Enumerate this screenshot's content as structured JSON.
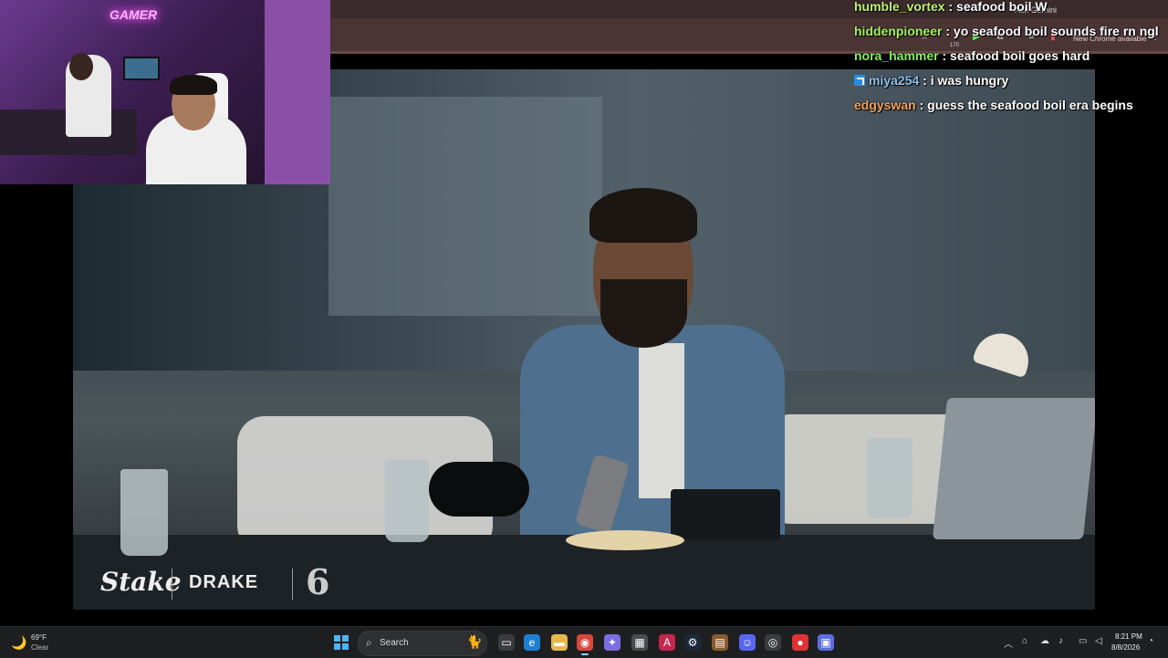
{
  "browser": {
    "ask_gemini": "Ask Gemini",
    "update_label": "New Chrome available",
    "extension_count": "170"
  },
  "chat": [
    {
      "user": "humble_vortex",
      "color": "#c6f26b",
      "message": "seafood boil W",
      "badge": false
    },
    {
      "user": "hiddenpioneer",
      "color": "#a4f25b",
      "message": "yo seafood boil sounds fire rn ngl",
      "badge": false
    },
    {
      "user": "nora_hammer",
      "color": "#86f25b",
      "message": "seafood boil goes hard",
      "badge": false
    },
    {
      "user": "miya254",
      "color": "#8fbfe8",
      "message": "i was hungry",
      "badge": true
    },
    {
      "user": "edgyswan",
      "color": "#f2a25b",
      "message": "guess the seafood boil era begins",
      "badge": false
    }
  ],
  "webcam": {
    "neon_sign": "GAMER"
  },
  "video": {
    "logos": {
      "stake": "Stake",
      "drake": "DRAKE",
      "six": "6"
    }
  },
  "taskbar": {
    "weather_temp": "69°F",
    "weather_desc": "Clear",
    "search_label": "Search",
    "clock_time": "8:21 PM",
    "clock_date": "8/8/2026",
    "apps": [
      {
        "name": "file-explorer-window-icon",
        "glyph": "▭",
        "color": "#3a3b40"
      },
      {
        "name": "edge-icon",
        "glyph": "e",
        "color": "#1f7fd0"
      },
      {
        "name": "folder-icon",
        "glyph": "▬",
        "color": "#e6b84a"
      },
      {
        "name": "chrome-icon",
        "glyph": "◉",
        "color": "#d9473a"
      },
      {
        "name": "copilot-icon",
        "glyph": "✦",
        "color": "#7d6ee0"
      },
      {
        "name": "store-icon",
        "glyph": "▦",
        "color": "#4a4b50"
      },
      {
        "name": "affinity-icon",
        "glyph": "A",
        "color": "#c7254e"
      },
      {
        "name": "steam-icon",
        "glyph": "⚙",
        "color": "#1b2838"
      },
      {
        "name": "winrar-icon",
        "glyph": "▤",
        "color": "#8a5a2b"
      },
      {
        "name": "discord-icon",
        "glyph": "☺",
        "color": "#5865f2"
      },
      {
        "name": "obs-icon",
        "glyph": "◎",
        "color": "#3a3b40"
      },
      {
        "name": "app-extra-icon",
        "glyph": "●",
        "color": "#d33"
      },
      {
        "name": "roblox-icon",
        "glyph": "▣",
        "color": "#5a6ee0"
      }
    ]
  }
}
